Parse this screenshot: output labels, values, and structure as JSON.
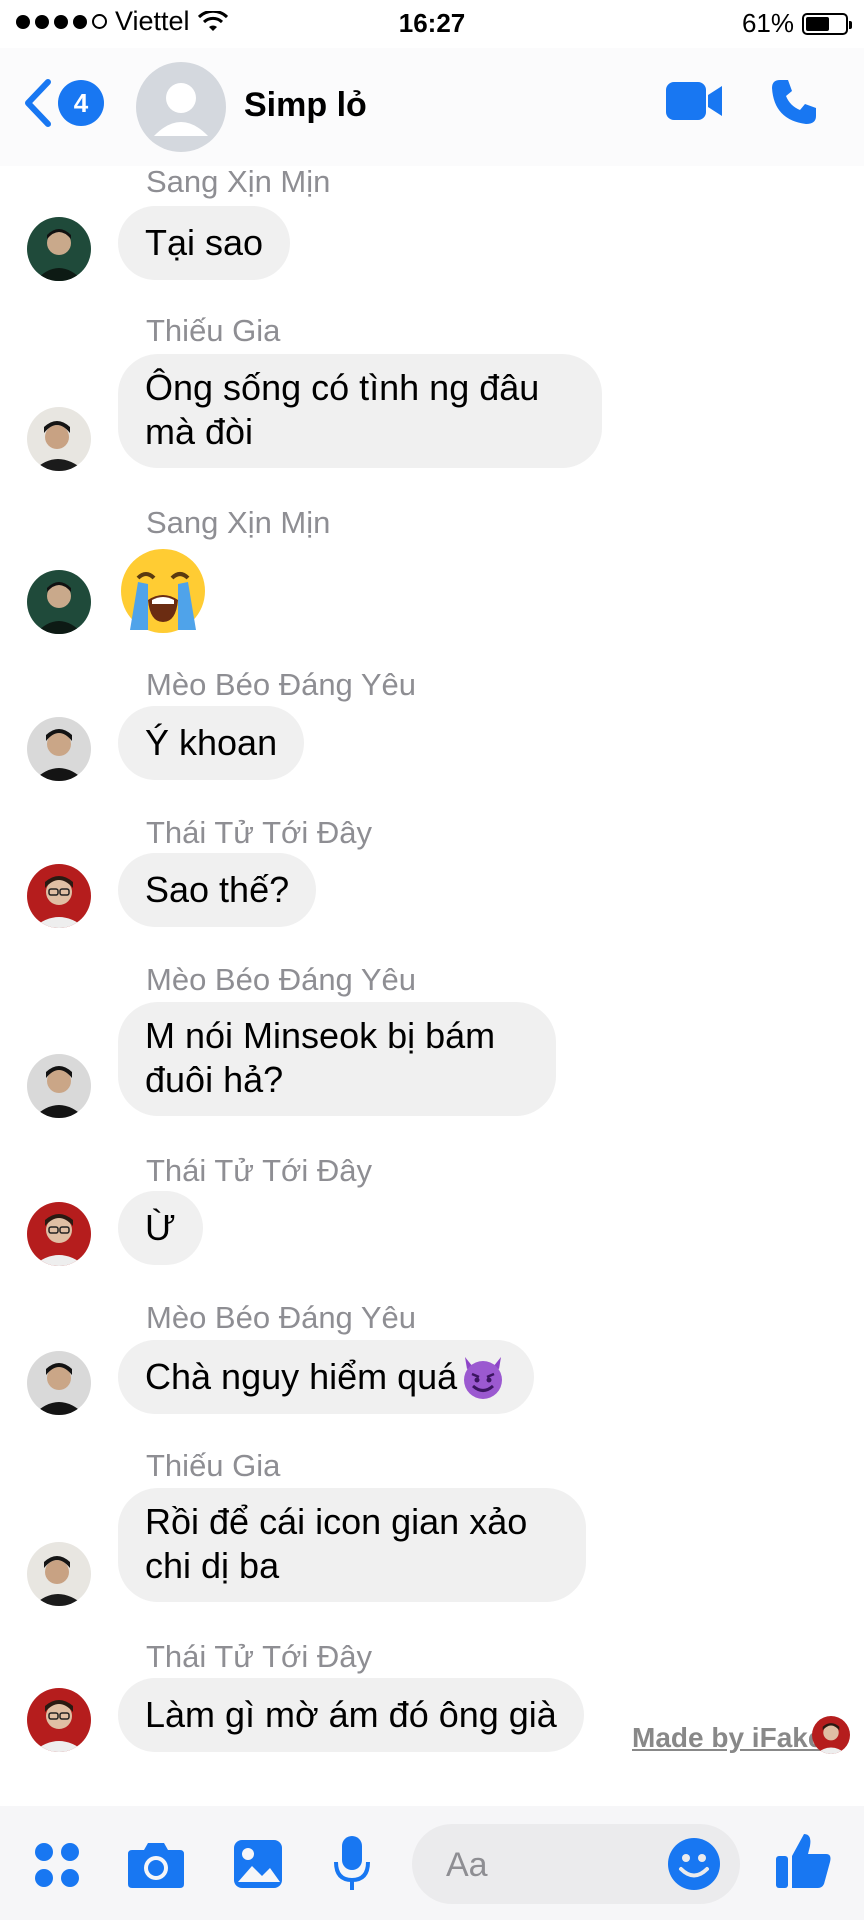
{
  "status_bar": {
    "carrier": "Viettel",
    "time": "16:27",
    "battery_percent": "61%",
    "battery_level": 0.61,
    "signal_bars": 4
  },
  "header": {
    "back_badge": "4",
    "title": "Simp lỏ",
    "accent_color": "#1877f2"
  },
  "messages": [
    {
      "sender": "Sang Xịn Mịn",
      "text": "Tại sao"
    },
    {
      "sender": "Thiếu Gia",
      "text_line1": "Ông sống có tình ng đâu",
      "text_line2": "mà đòi"
    },
    {
      "sender": "Sang Xịn Mịn",
      "emoji": "loudly-crying-face"
    },
    {
      "sender": "Mèo Béo Đáng Yêu",
      "text": "Ý khoan"
    },
    {
      "sender": "Thái Tử Tới Đây",
      "text": "Sao thế?"
    },
    {
      "sender": "Mèo Béo Đáng Yêu",
      "text_line1": "M nói Minseok bị bám",
      "text_line2": "đuôi hả?"
    },
    {
      "sender": "Thái Tử Tới Đây",
      "text": "Ừ"
    },
    {
      "sender": "Mèo Béo Đáng Yêu",
      "text": "Chà nguy hiểm quá",
      "emoji": "smiling-devil"
    },
    {
      "sender": "Thiếu Gia",
      "text_line1": "Rồi để cái icon gian xảo",
      "text_line2": "chi dị ba"
    },
    {
      "sender": "Thái Tử Tới Đây",
      "text": "Làm gì mờ ám đó ông già"
    }
  ],
  "watermark": "Made by iFake",
  "composer": {
    "placeholder": "Aa"
  }
}
